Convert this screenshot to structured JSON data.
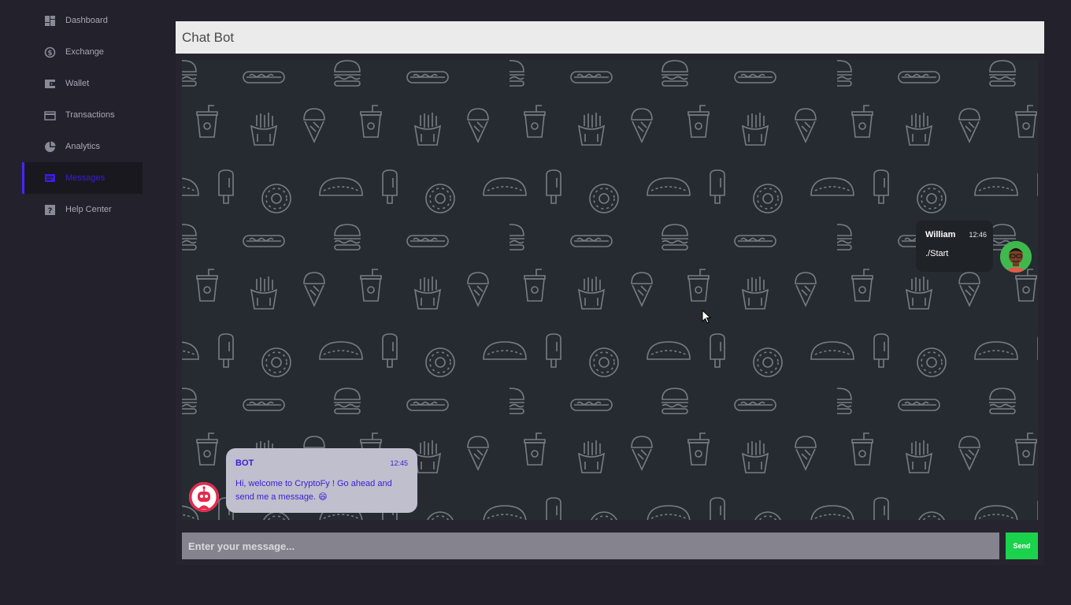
{
  "sidebar": {
    "items": [
      {
        "label": "Dashboard",
        "icon": "dashboard-icon"
      },
      {
        "label": "Exchange",
        "icon": "exchange-icon"
      },
      {
        "label": "Wallet",
        "icon": "wallet-icon"
      },
      {
        "label": "Transactions",
        "icon": "card-icon"
      },
      {
        "label": "Analytics",
        "icon": "pie-chart-icon"
      },
      {
        "label": "Messages",
        "icon": "chat-icon",
        "active": true
      },
      {
        "label": "Help Center",
        "icon": "help-icon"
      }
    ]
  },
  "chat": {
    "title": "Chat Bot",
    "messages": [
      {
        "author": "William",
        "time": "12:46",
        "text": "./Start",
        "side": "right"
      },
      {
        "author": "BOT",
        "time": "12:45",
        "text": "Hi, welcome to CryptoFy ! Go ahead and send me a message. 😄",
        "side": "left"
      }
    ]
  },
  "composer": {
    "placeholder": "Enter your message...",
    "value": "",
    "send_label": "Send"
  },
  "colors": {
    "accent": "#3d1cd9",
    "send": "#1bd24c",
    "background": "#22212c",
    "chat_background": "#262b32"
  }
}
